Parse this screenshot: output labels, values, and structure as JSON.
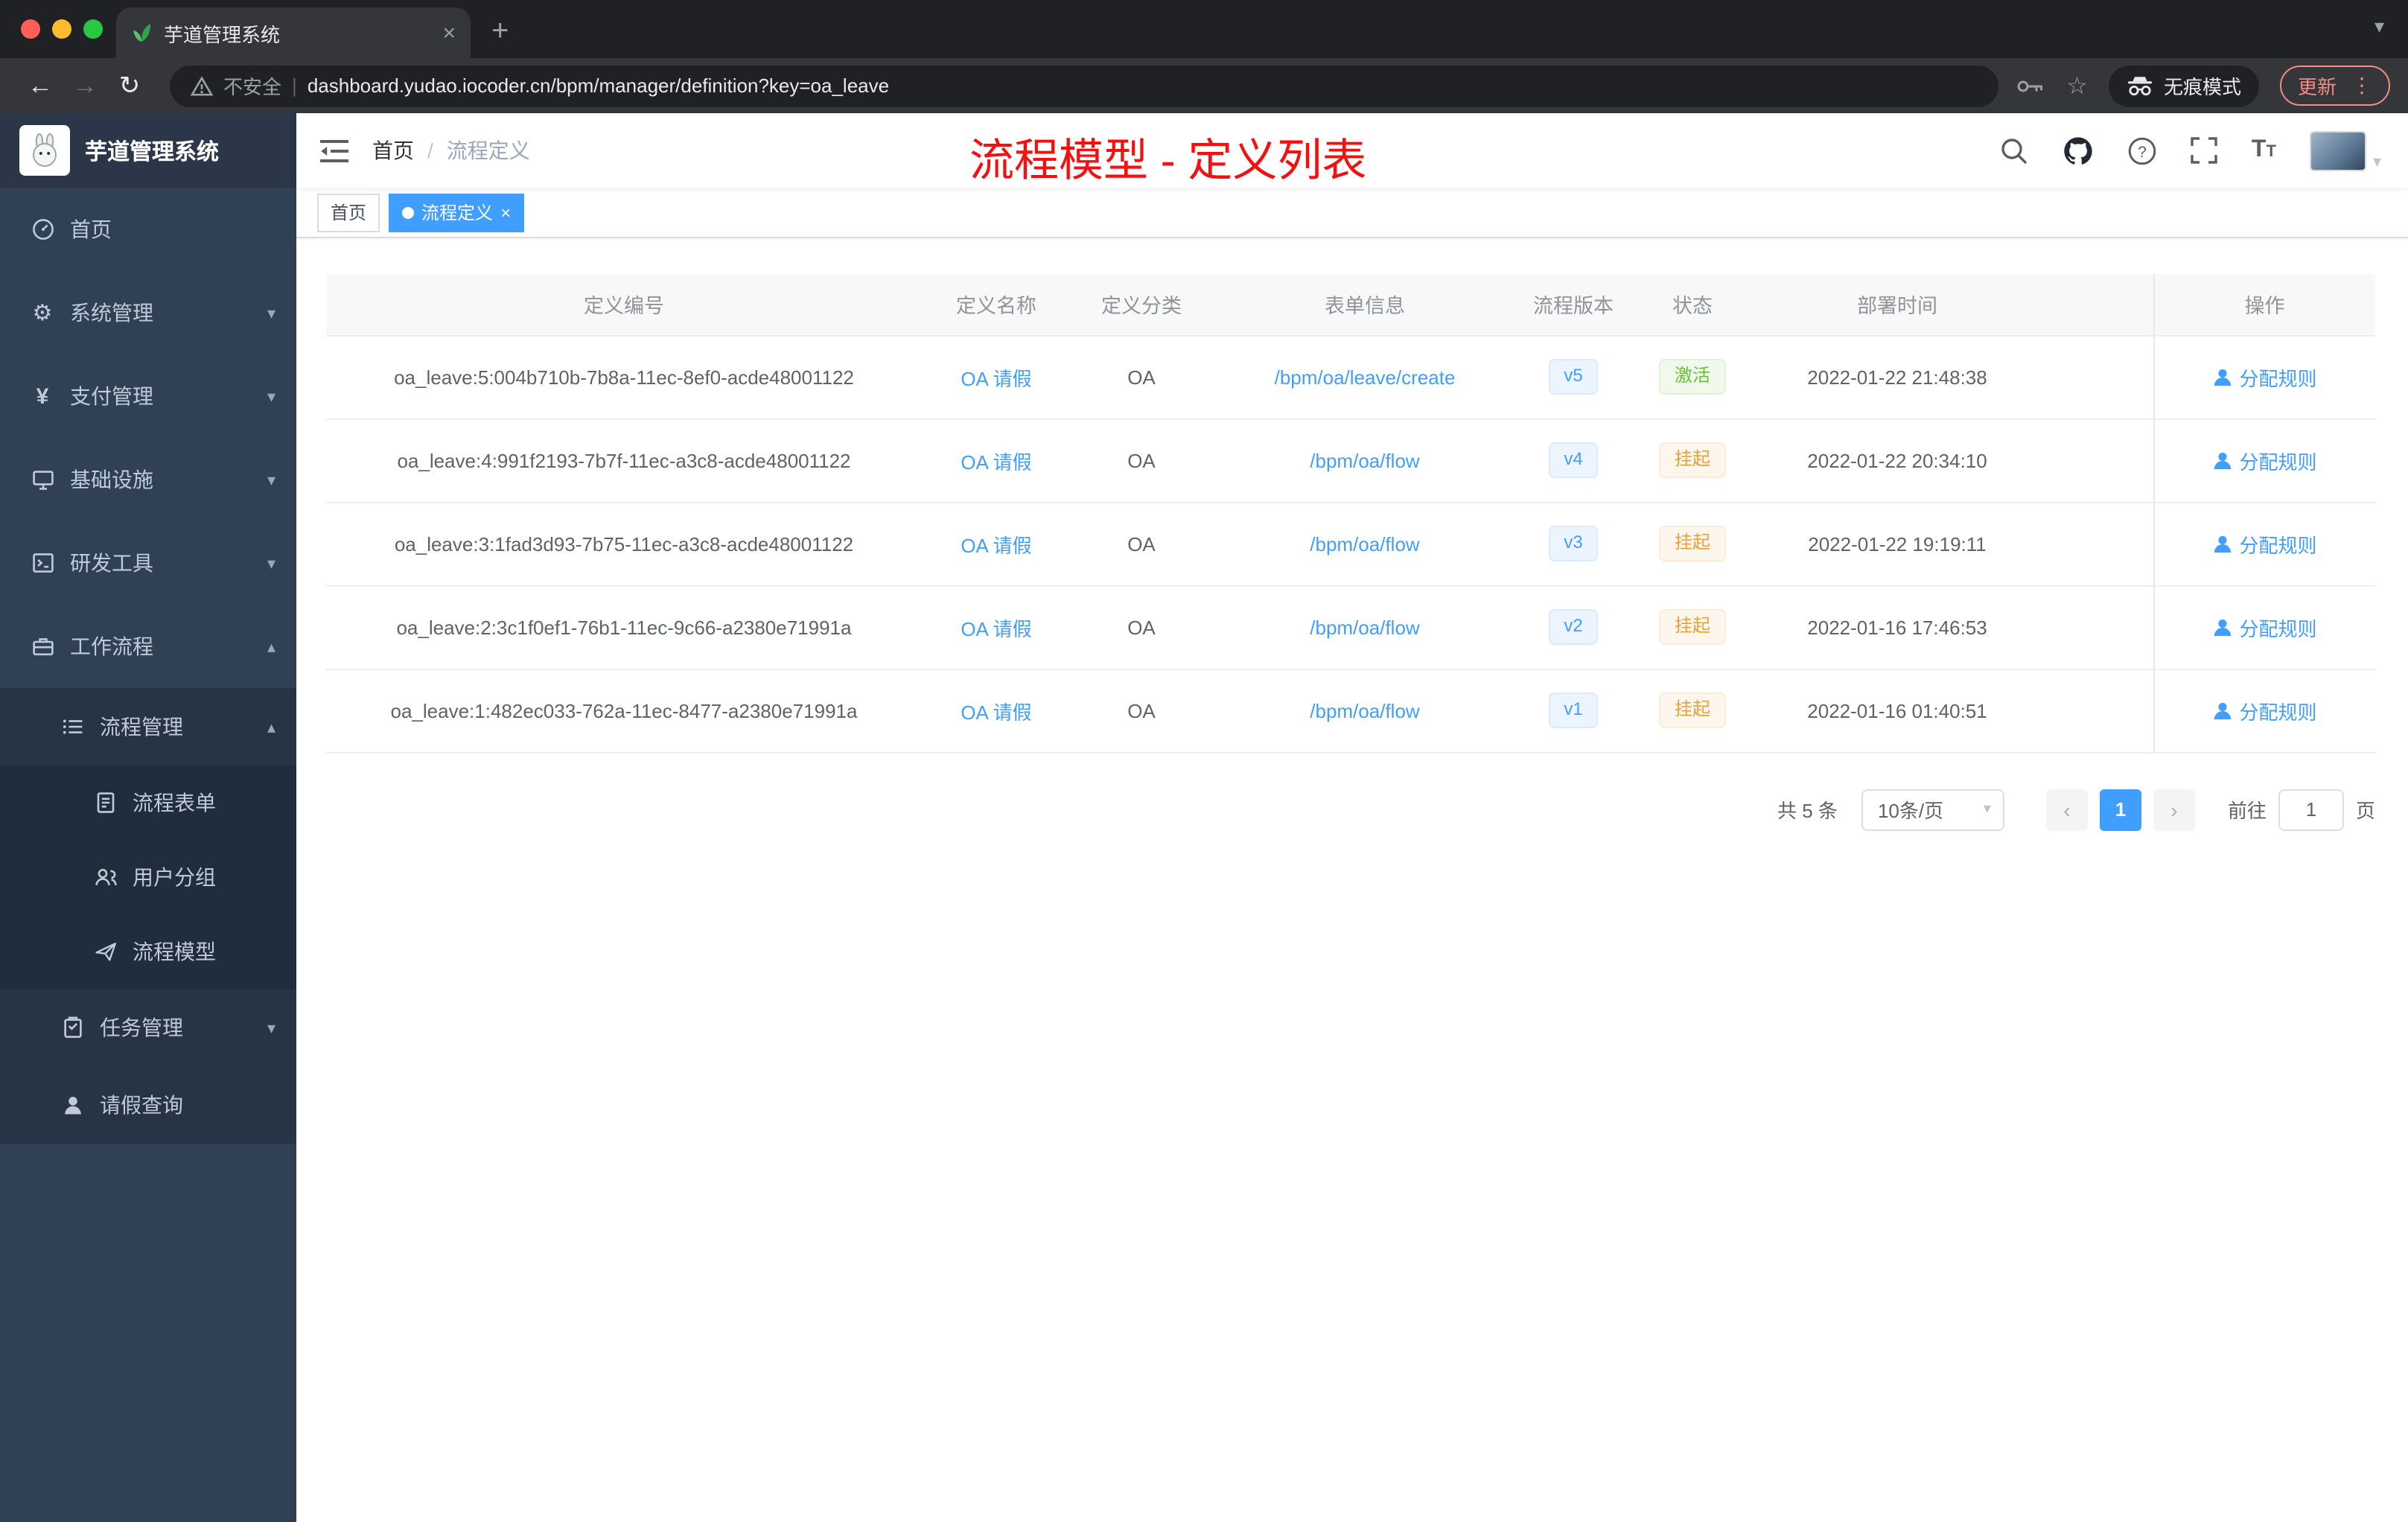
{
  "browser": {
    "tab_title": "芋道管理系统",
    "new_tab_glyph": "+",
    "back_glyph": "←",
    "forward_glyph": "→",
    "reload_glyph": "↻",
    "security_label": "不安全",
    "url": "dashboard.yudao.iocoder.cn/bpm/manager/definition?key=oa_leave",
    "star_glyph": "☆",
    "incognito_label": "无痕模式",
    "update_label": "更新",
    "kebab_glyph": "⋮",
    "tabsearch_glyph": "▾"
  },
  "sidebar": {
    "app_title": "芋道管理系统",
    "items": [
      {
        "label": "首页",
        "icon": "dashboard-icon"
      },
      {
        "label": "系统管理",
        "icon": "gear-icon"
      },
      {
        "label": "支付管理",
        "icon": "payment-icon"
      },
      {
        "label": "基础设施",
        "icon": "infrastructure-icon"
      },
      {
        "label": "研发工具",
        "icon": "devtools-icon"
      },
      {
        "label": "工作流程",
        "icon": "workflow-icon"
      },
      {
        "label": "流程管理",
        "icon": "process-management-icon"
      },
      {
        "label": "流程表单",
        "icon": "form-icon"
      },
      {
        "label": "用户分组",
        "icon": "user-group-icon"
      },
      {
        "label": "流程模型",
        "icon": "model-icon"
      },
      {
        "label": "任务管理",
        "icon": "task-icon"
      },
      {
        "label": "请假查询",
        "icon": "leave-query-icon"
      }
    ],
    "chevron_down": "▾",
    "chevron_up": "▴"
  },
  "navbar": {
    "breadcrumb": {
      "home": "首页",
      "separator": "/",
      "current": "流程定义"
    },
    "annotation": "流程模型 - 定义列表"
  },
  "tags": {
    "home": "首页",
    "active": "流程定义",
    "close_glyph": "×"
  },
  "table": {
    "columns": {
      "id": "定义编号",
      "name": "定义名称",
      "category": "定义分类",
      "form": "表单信息",
      "version": "流程版本",
      "status": "状态",
      "deploy_time": "部署时间",
      "actions": "操作"
    },
    "rows": [
      {
        "id": "oa_leave:5:004b710b-7b8a-11ec-8ef0-acde48001122",
        "name": "OA 请假",
        "category": "OA",
        "form": "/bpm/oa/leave/create",
        "version": "v5",
        "status": "激活",
        "status_type": "success",
        "deploy_time": "2022-01-22 21:48:38",
        "action": "分配规则"
      },
      {
        "id": "oa_leave:4:991f2193-7b7f-11ec-a3c8-acde48001122",
        "name": "OA 请假",
        "category": "OA",
        "form": "/bpm/oa/flow",
        "version": "v4",
        "status": "挂起",
        "status_type": "warning",
        "deploy_time": "2022-01-22 20:34:10",
        "action": "分配规则"
      },
      {
        "id": "oa_leave:3:1fad3d93-7b75-11ec-a3c8-acde48001122",
        "name": "OA 请假",
        "category": "OA",
        "form": "/bpm/oa/flow",
        "version": "v3",
        "status": "挂起",
        "status_type": "warning",
        "deploy_time": "2022-01-22 19:19:11",
        "action": "分配规则"
      },
      {
        "id": "oa_leave:2:3c1f0ef1-76b1-11ec-9c66-a2380e71991a",
        "name": "OA 请假",
        "category": "OA",
        "form": "/bpm/oa/flow",
        "version": "v2",
        "status": "挂起",
        "status_type": "warning",
        "deploy_time": "2022-01-16 17:46:53",
        "action": "分配规则"
      },
      {
        "id": "oa_leave:1:482ec033-762a-11ec-8477-a2380e71991a",
        "name": "OA 请假",
        "category": "OA",
        "form": "/bpm/oa/flow",
        "version": "v1",
        "status": "挂起",
        "status_type": "warning",
        "deploy_time": "2022-01-16 01:40:51",
        "action": "分配规则"
      }
    ]
  },
  "pagination": {
    "total": "共 5 条",
    "page_size": "10条/页",
    "prev_glyph": "‹",
    "next_glyph": "›",
    "current_page": "1",
    "goto": "前往",
    "page_unit": "页"
  },
  "icons": {
    "search-icon": "magnifier-svg",
    "github-icon": "octocat-svg",
    "help-icon": "question-circle-svg",
    "fullscreen-icon": "expand-corners-svg",
    "font-size-icon": "TT",
    "gear-icon": "⚙",
    "payment-icon": "¥",
    "warning-icon": "triangle-exclamation-svg",
    "key-icon": "key-svg",
    "incognito-icon": "hat-glasses-svg",
    "assign-user-icon": "person-svg"
  },
  "colors": {
    "accent": "#409eff",
    "annotation_red": "#f50f0f",
    "sidebar_bg": "#304156",
    "status_active_green": "#67c23a",
    "status_suspend_orange": "#e6a23c"
  }
}
